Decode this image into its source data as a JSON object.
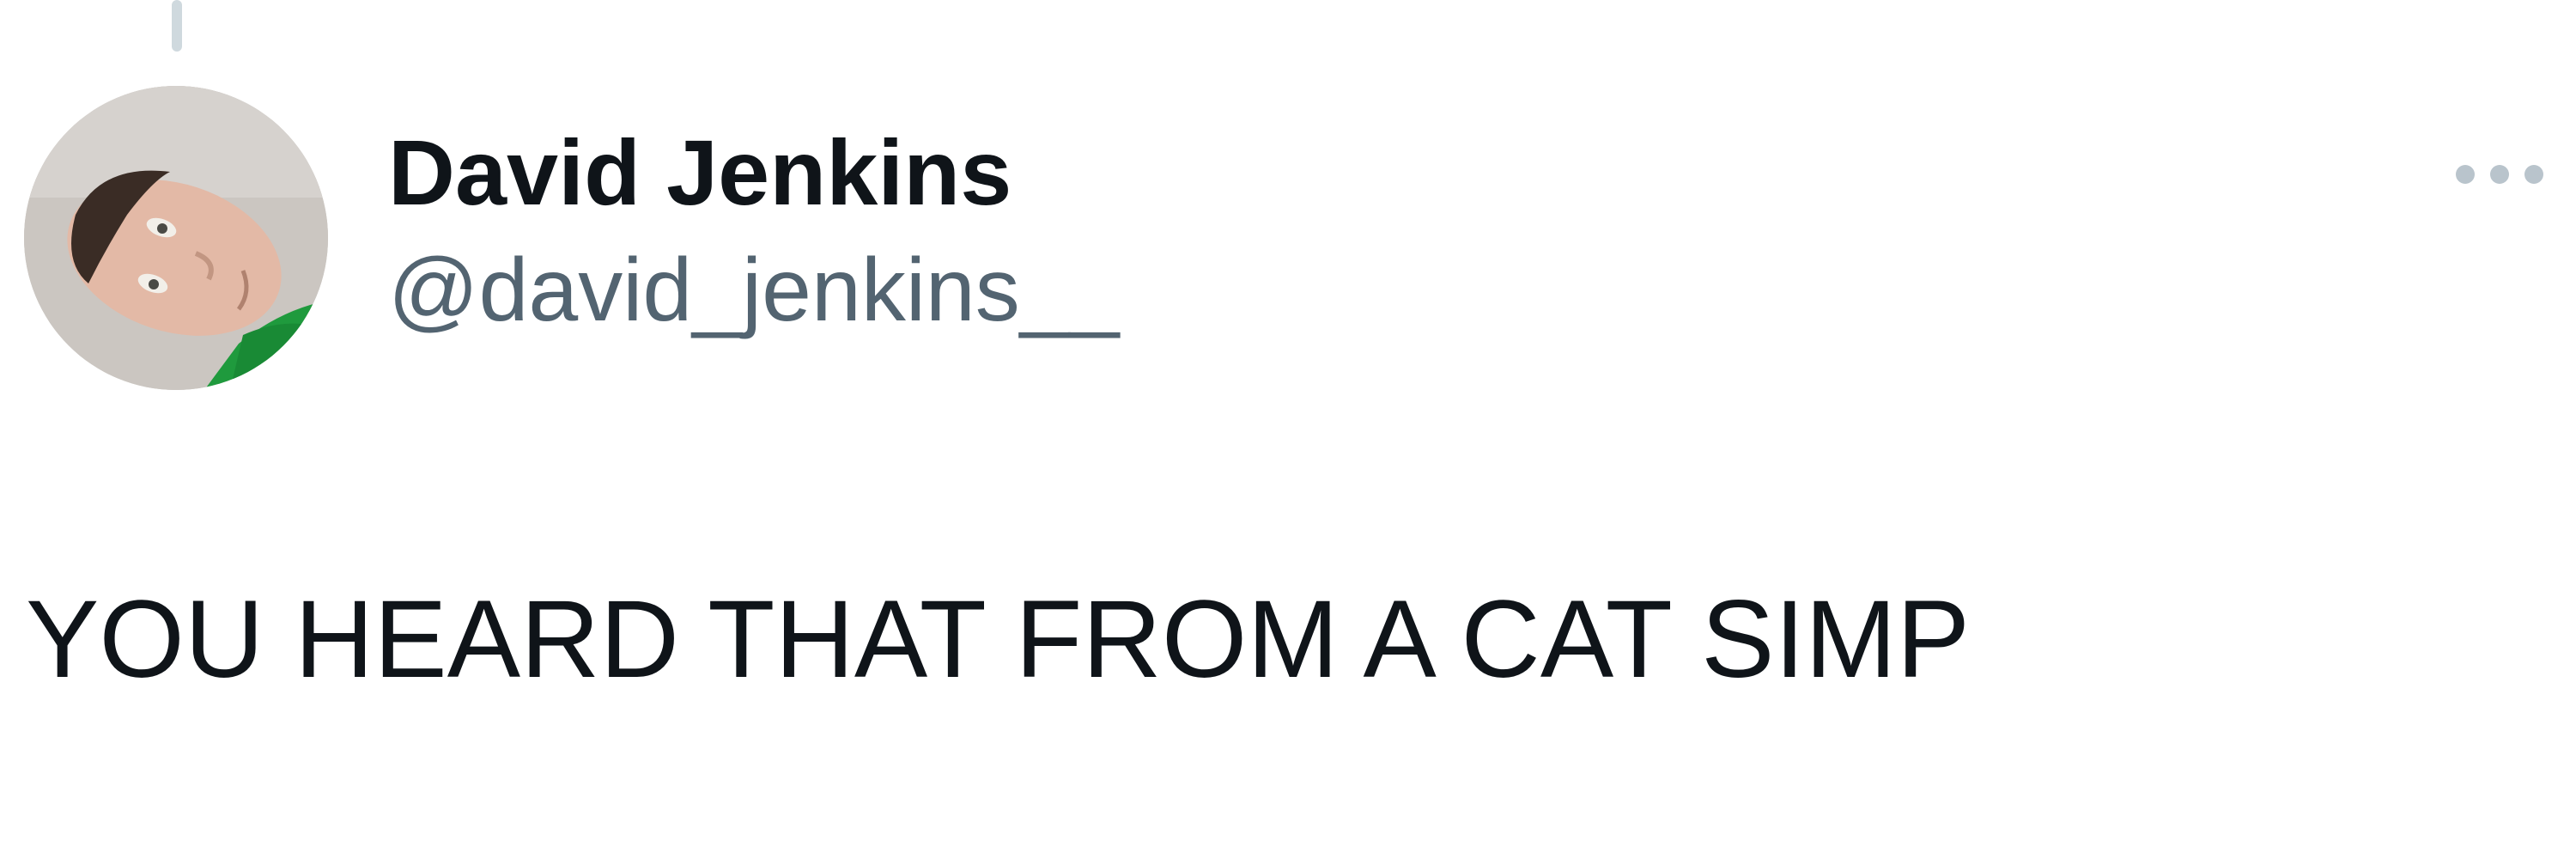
{
  "tweet": {
    "author": {
      "display_name": "David Jenkins",
      "handle": "@david_jenkins__",
      "avatar_icon": "profile-photo"
    },
    "more_icon": "more-horizontal-icon",
    "text": "YOU HEARD THAT FROM A CAT SIMP"
  },
  "colors": {
    "primary_text": "#0f1419",
    "secondary_text": "#536471",
    "icon": "#b9c4cc",
    "thread_line": "#cfd9de",
    "background": "#ffffff"
  }
}
